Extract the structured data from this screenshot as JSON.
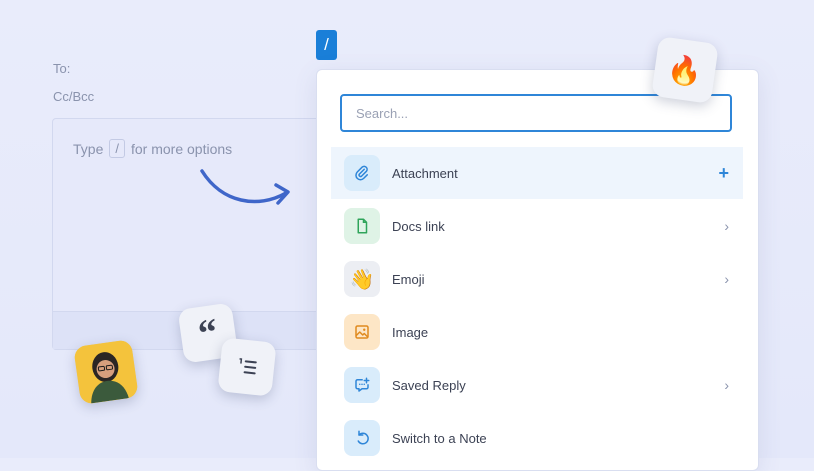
{
  "compose": {
    "to_label": "To:",
    "cc_label": "Cc/Bcc",
    "hint_prefix": "Type",
    "hint_slash": "/",
    "hint_suffix": "for more options"
  },
  "slash_badge": "/",
  "menu": {
    "search_placeholder": "Search...",
    "items": [
      {
        "label": "Attachment",
        "icon": "paperclip-icon",
        "trail": "+"
      },
      {
        "label": "Docs link",
        "icon": "document-icon",
        "trail": "›"
      },
      {
        "label": "Emoji",
        "icon": "waving-hand-icon",
        "trail": "›"
      },
      {
        "label": "Image",
        "icon": "image-icon",
        "trail": ""
      },
      {
        "label": "Saved Reply",
        "icon": "saved-reply-icon",
        "trail": "›"
      },
      {
        "label": "Switch to a Note",
        "icon": "undo-icon",
        "trail": ""
      }
    ]
  },
  "tiles": {
    "fire": "🔥",
    "quote": "“",
    "wave": "👋"
  },
  "colors": {
    "accent": "#2f86d8",
    "background": "#e9ecfb",
    "badge": "#1a7fd8"
  }
}
